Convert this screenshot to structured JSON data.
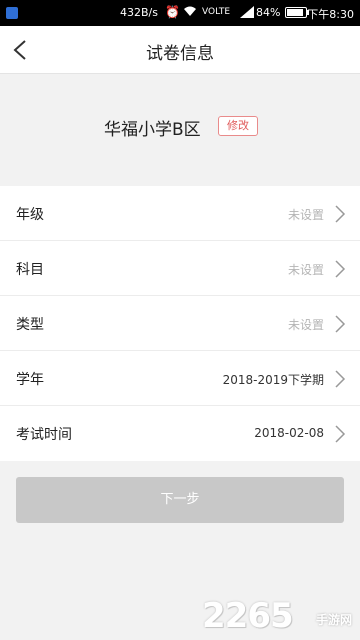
{
  "status_bar": {
    "net_speed": "432B/s",
    "network_label": "VOLTE",
    "battery_percent": "84%",
    "time": "下午8:30"
  },
  "header": {
    "title": "试卷信息"
  },
  "school": {
    "name": "华福小学B区",
    "edit_label": "修改"
  },
  "fields": [
    {
      "label": "年级",
      "value": "未设置",
      "is_placeholder": true
    },
    {
      "label": "科目",
      "value": "未设置",
      "is_placeholder": true
    },
    {
      "label": "类型",
      "value": "未设置",
      "is_placeholder": true
    },
    {
      "label": "学年",
      "value": "2018-2019下学期",
      "is_placeholder": false
    },
    {
      "label": "考试时间",
      "value": "2018-02-08",
      "is_placeholder": false
    }
  ],
  "next_button": {
    "label": "下一步"
  },
  "watermark": {
    "number": "2265",
    "site": "手游网"
  },
  "colors": {
    "edit_badge": "#e05a5a",
    "placeholder_text": "#b5b5b5",
    "disabled_button": "#c8c8c8"
  }
}
